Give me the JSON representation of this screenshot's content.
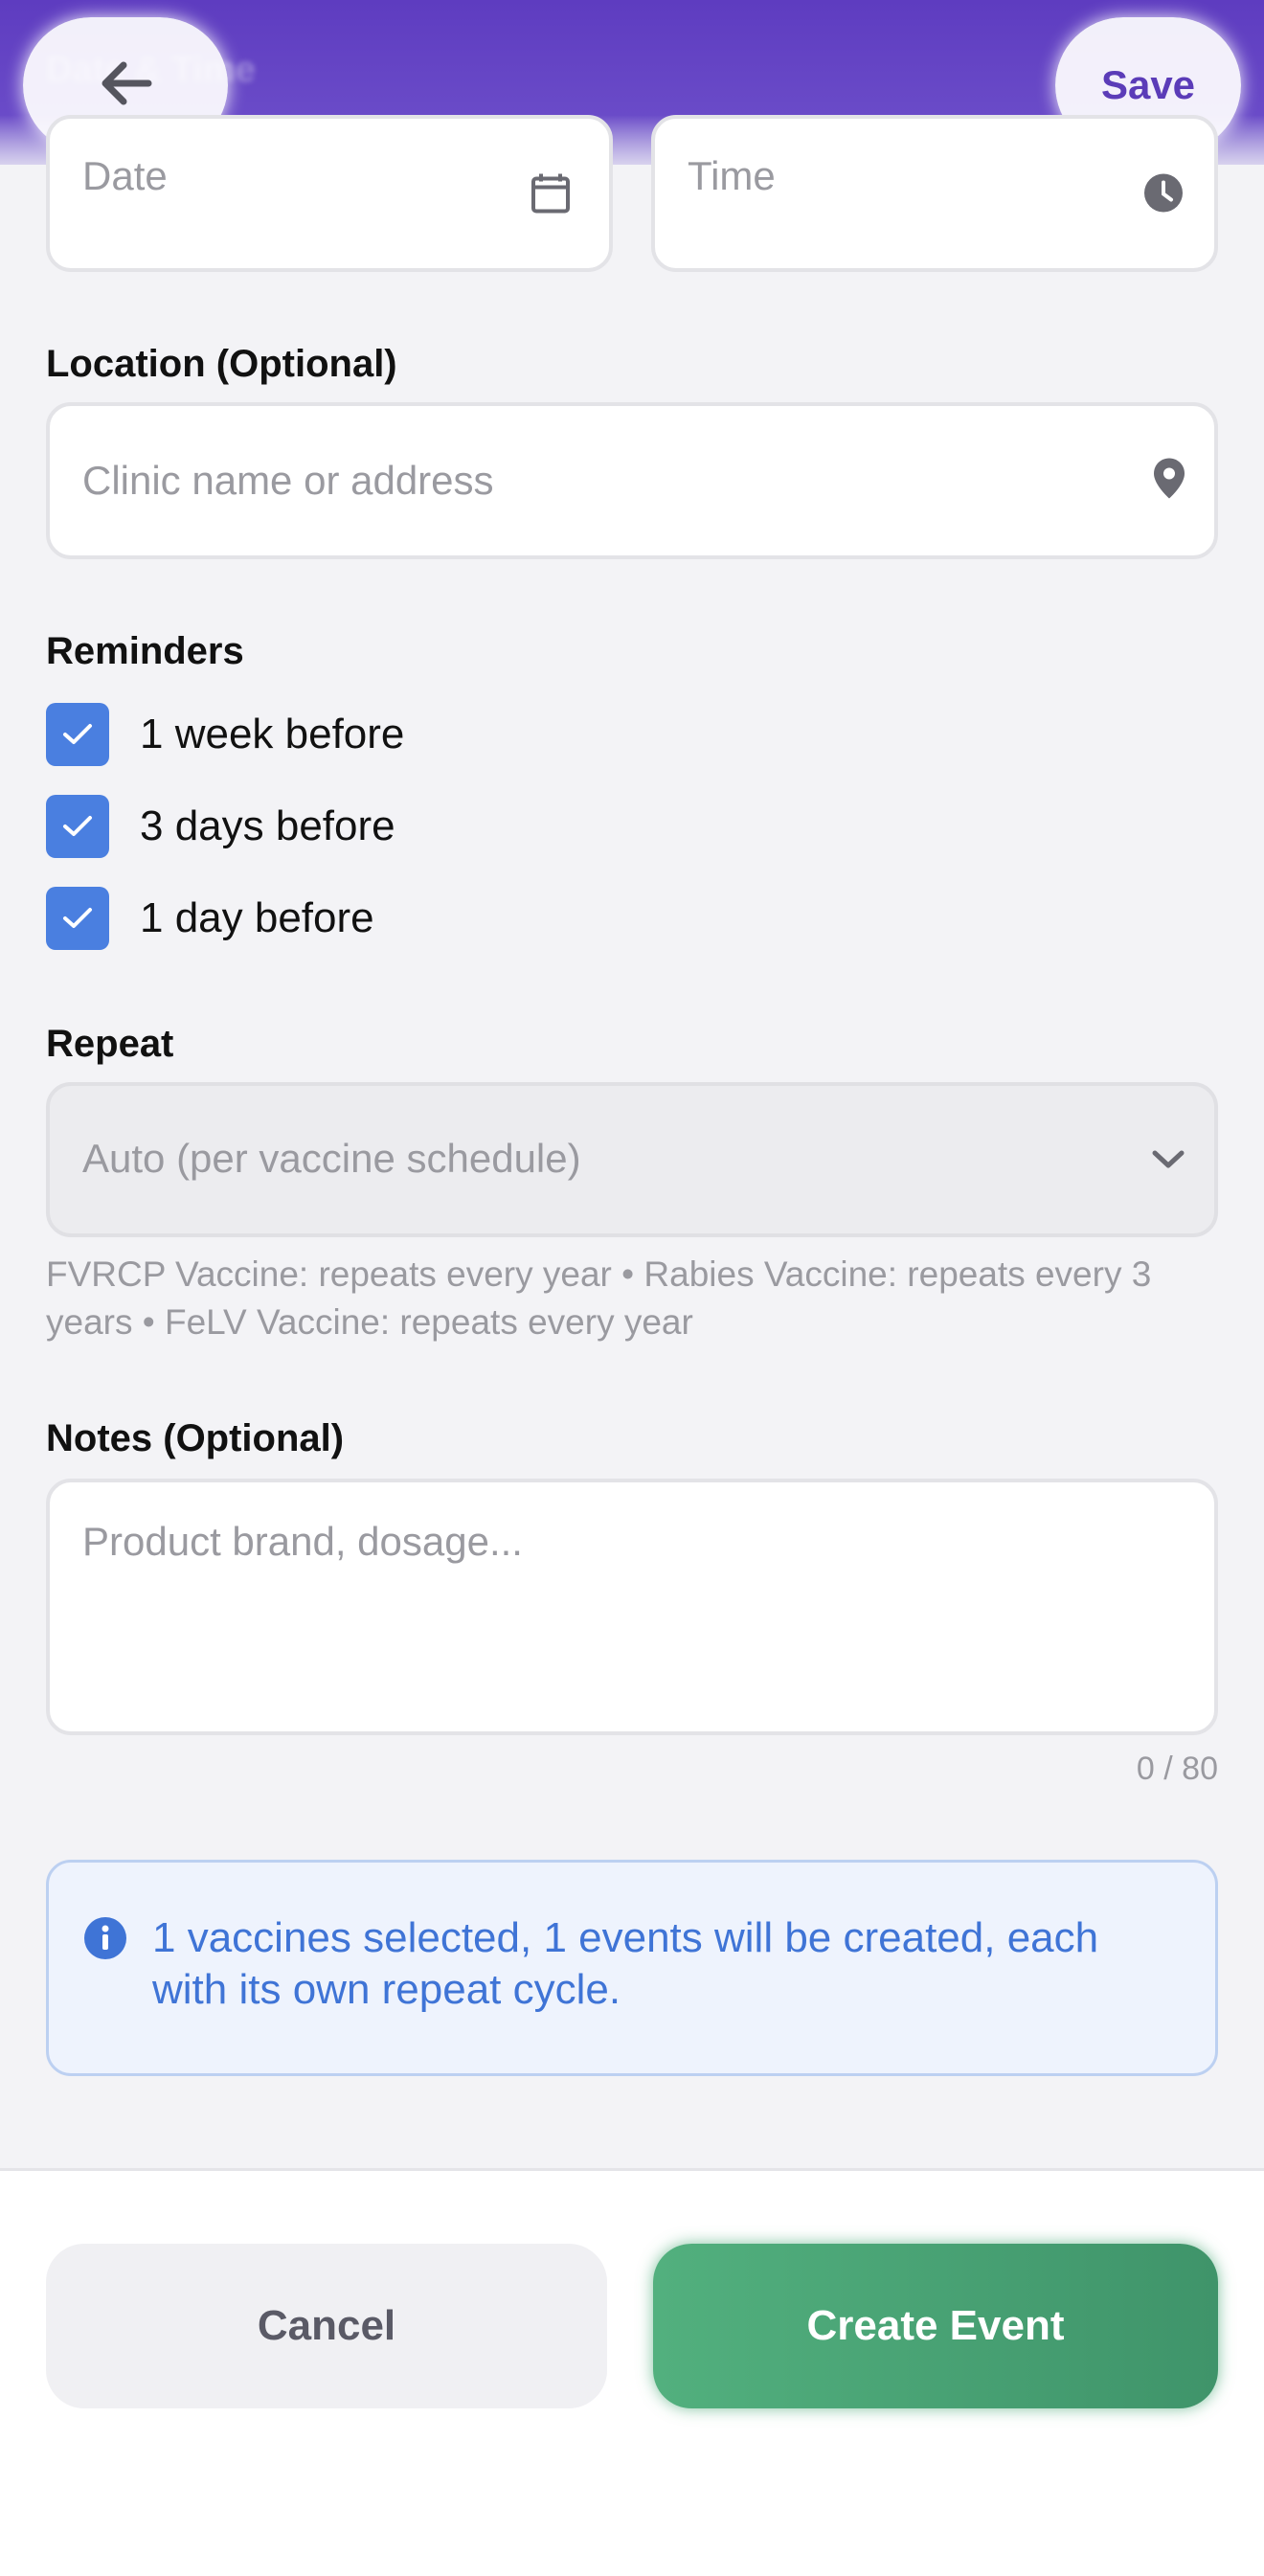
{
  "header": {
    "title": "Date & Time",
    "back_icon": "arrow-left-icon",
    "save_label": "Save"
  },
  "date_time": {
    "date_placeholder": "Date",
    "date_icon": "calendar-icon",
    "time_placeholder": "Time",
    "time_icon": "clock-icon"
  },
  "location": {
    "label": "Location (Optional)",
    "placeholder": "Clinic name or address",
    "icon": "map-pin-icon"
  },
  "reminders": {
    "label": "Reminders",
    "items": [
      {
        "label": "1 week before",
        "checked": true
      },
      {
        "label": "3 days before",
        "checked": true
      },
      {
        "label": "1 day before",
        "checked": true
      }
    ]
  },
  "repeat": {
    "label": "Repeat",
    "selected": "Auto (per vaccine schedule)",
    "hint": "FVRCP Vaccine: repeats every year • Rabies Vaccine: repeats every 3 years • FeLV Vaccine: repeats every year"
  },
  "notes": {
    "label": "Notes (Optional)",
    "placeholder": "Product brand, dosage...",
    "counter": "0 / 80"
  },
  "info": {
    "icon": "info-icon",
    "text": "1 vaccines selected, 1 events will be created, each with its own repeat cycle."
  },
  "footer": {
    "cancel_label": "Cancel",
    "create_label": "Create Event"
  },
  "colors": {
    "header": "#5e3cc0",
    "checkbox": "#4a7fe0",
    "create_button": "#4aa574",
    "info_text": "#3f74d6"
  }
}
